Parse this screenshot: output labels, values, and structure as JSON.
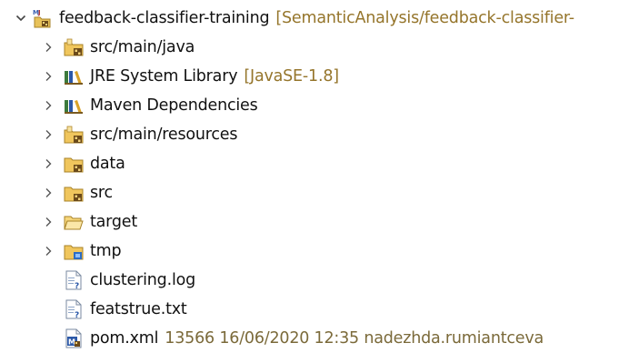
{
  "project": {
    "name": "feedback-classifier-training",
    "decoration": "[SemanticAnalysis/feedback-classifier-",
    "icon": "maven-java-project-icon",
    "expanded": true
  },
  "children": [
    {
      "label": "src/main/java",
      "icon": "source-folder-icon",
      "expandable": true
    },
    {
      "label": "JRE System Library",
      "decoration": "[JavaSE-1.8]",
      "icon": "library-icon",
      "expandable": true
    },
    {
      "label": "Maven Dependencies",
      "icon": "library-icon",
      "expandable": true
    },
    {
      "label": "src/main/resources",
      "icon": "source-folder-icon",
      "expandable": true
    },
    {
      "label": "data",
      "icon": "folder-icon",
      "expandable": true
    },
    {
      "label": "src",
      "icon": "folder-icon",
      "expandable": true
    },
    {
      "label": "target",
      "icon": "open-folder-icon",
      "expandable": true
    },
    {
      "label": "tmp",
      "icon": "folder-icon",
      "expandable": true
    },
    {
      "label": "clustering.log",
      "icon": "unknown-file-icon",
      "expandable": false
    },
    {
      "label": "featstrue.txt",
      "icon": "text-file-icon",
      "expandable": false
    },
    {
      "label": "pom.xml",
      "decoration": "13566  16/06/2020 12:35  nadezhda.rumiantceva",
      "icon": "maven-pom-icon",
      "expandable": false
    }
  ]
}
